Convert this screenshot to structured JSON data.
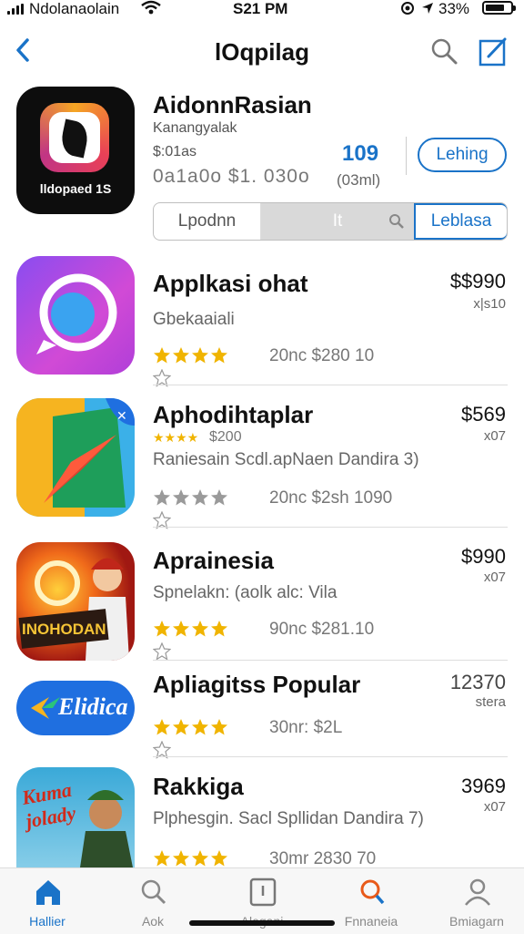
{
  "status": {
    "carrier": "Ndolanaolain",
    "time": "S21 PM",
    "battery": "33%"
  },
  "nav": {
    "title": "lOqpilag"
  },
  "featured": {
    "icon_text": "lldopaed 1S",
    "name": "AidonnRasian",
    "sub1": "Kanangyalak",
    "sub2": "$:01as",
    "sub3": "0a1a0o $1. 030o",
    "count": "109",
    "count_label": "(03ml)",
    "get_label": "Lehing",
    "segments": [
      "Lpodnn",
      "It",
      "Leblasa"
    ]
  },
  "apps": [
    {
      "name": "Applkasi ohat",
      "sub": "Gbekaaiali",
      "price": "$$990",
      "price_sub": "x|s10",
      "meta": "20nc $280 10",
      "rating": 4.5,
      "icon": "chat-bubble-icon",
      "colors": [
        "#7b3fe4",
        "#d34bd6"
      ]
    },
    {
      "name": "Aphodihtaplar",
      "mini_stars": "★★★★",
      "mini_val": "$200",
      "sub": "Raniesain Scdl.apNaen Dandira 3)",
      "price": "$569",
      "price_sub": "x07",
      "meta": "20nc $2sh 1090",
      "rating": 4.5,
      "icon": "maps-icon",
      "colors": [
        "#f6b420",
        "#3bb0e8"
      ]
    },
    {
      "name": "Aprainesia",
      "sub": "Spnelakn: (aolk alc: Vila",
      "price": "$990",
      "price_sub": "x07",
      "meta": "90nc $281.10",
      "rating": 4.5,
      "icon": "game-character-icon",
      "icon_text": "INOHODAN",
      "colors": [
        "#c0261a",
        "#f08a1a"
      ]
    },
    {
      "name": "Apliagitss Popular",
      "price": "12370",
      "price_sub": "stera",
      "meta": "30nr: $2L",
      "rating": 4.5,
      "icon": "elidica-logo-icon",
      "icon_text": "Elidica",
      "colors": [
        "#1f6fe0",
        "#ffffff"
      ]
    },
    {
      "name": "Rakkiga",
      "sub": "Plphesgin. Sacl Spllidan Dandira 7)",
      "price": "3969",
      "price_sub": "x07",
      "meta": "30mr 2830 70",
      "rating": 4.5,
      "icon": "comic-game-icon",
      "icon_text": "Kuma jolady",
      "colors": [
        "#3aa9d8",
        "#f2c12e"
      ]
    }
  ],
  "tabs": [
    {
      "label": "Hallier",
      "icon": "home-icon",
      "active": true
    },
    {
      "label": "Aok",
      "icon": "search-icon",
      "active": false
    },
    {
      "label": "Alegani",
      "icon": "apps-icon",
      "active": false
    },
    {
      "label": "Fnnaneia",
      "icon": "search-icon",
      "active": false
    },
    {
      "label": "Bmiagarn",
      "icon": "person-icon",
      "active": false
    }
  ],
  "colors": {
    "accent": "#1a73c8",
    "star": "#f0b400",
    "tab_active": "#1a73c8"
  }
}
